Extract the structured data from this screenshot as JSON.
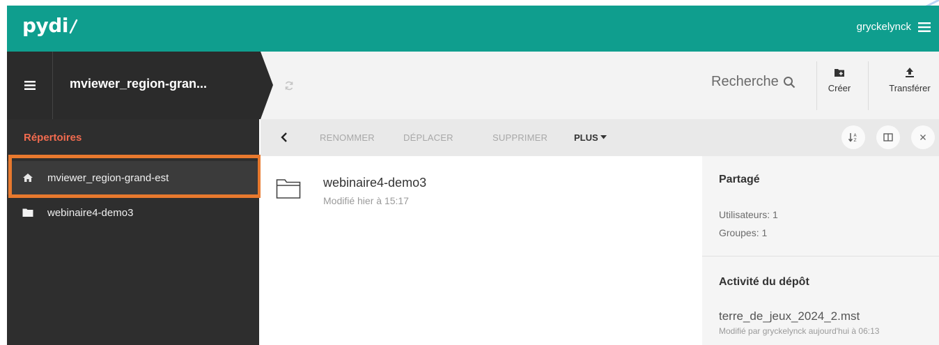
{
  "app": {
    "logo_text": "pydi",
    "user_name": "gryckelynck"
  },
  "colors": {
    "brand": "#0f9e8e",
    "sidebar_bg": "#2e2e2e",
    "accent": "#f26b4f",
    "highlight": "#e8792e"
  },
  "workspace": {
    "title": "mviewer_region-gran..."
  },
  "toolbar": {
    "search_label": "Recherche",
    "create_label": "Créer",
    "upload_label": "Transférer"
  },
  "sidebar": {
    "heading": "Répertoires",
    "items": [
      {
        "label": "mviewer_region-grand-est",
        "icon": "home-icon"
      },
      {
        "label": "webinaire4-demo3",
        "icon": "folder-icon"
      }
    ]
  },
  "selection_bar": {
    "rename": "RENOMMER",
    "move": "DÉPLACER",
    "delete": "SUPPRIMER",
    "more": "PLUS"
  },
  "files": [
    {
      "name": "webinaire4-demo3",
      "meta": "Modifié hier à 15:17"
    }
  ],
  "info_panel": {
    "shared_title": "Partagé",
    "users": "Utilisateurs: 1",
    "groups": "Groupes: 1",
    "activity_title": "Activité du dépôt",
    "activity_file": "terre_de_jeux_2024_2.mst",
    "activity_meta": "Modifié par gryckelynck aujourd'hui à 06:13"
  }
}
